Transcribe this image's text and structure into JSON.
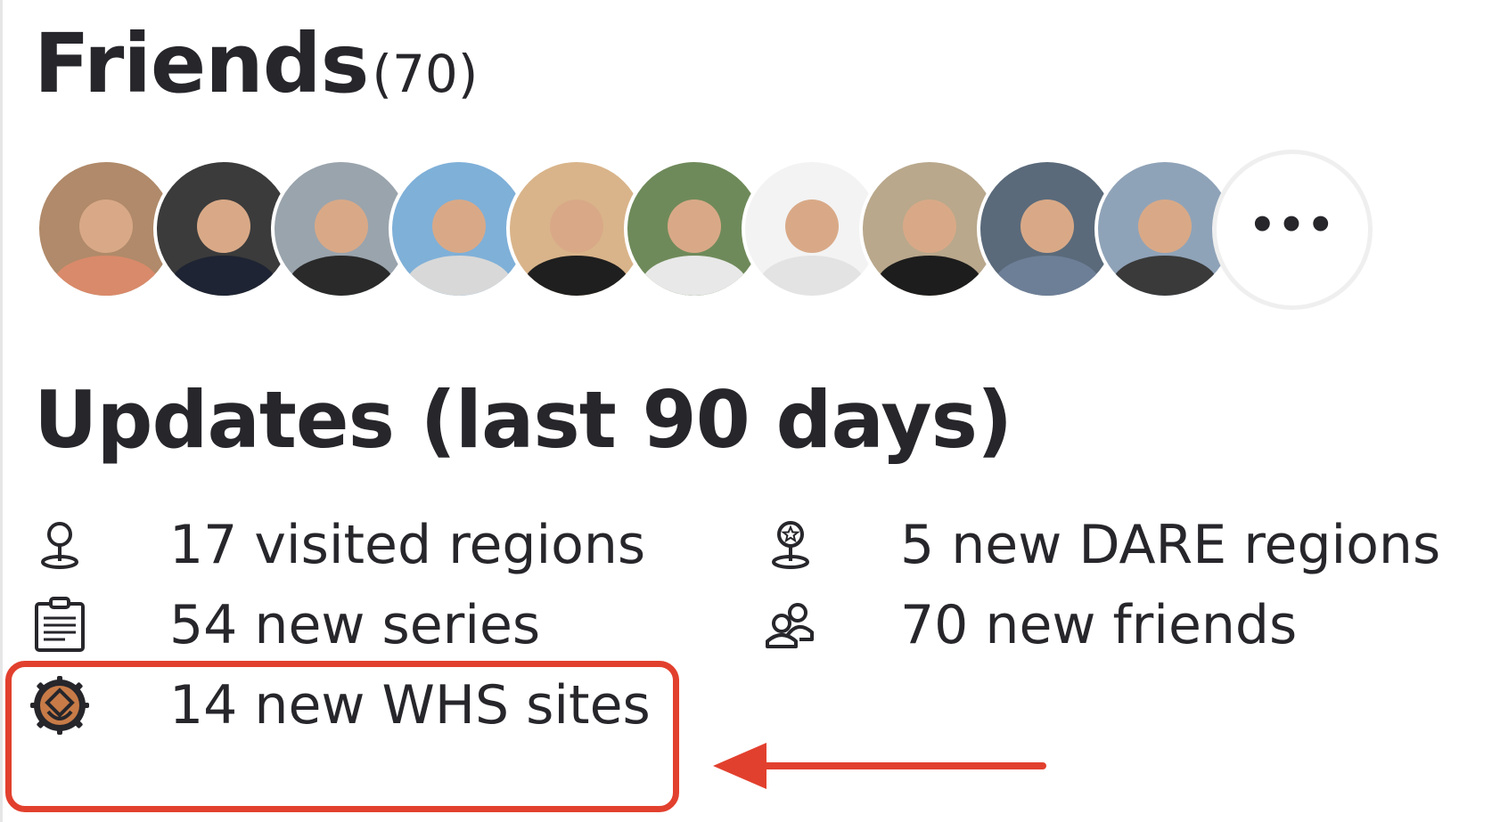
{
  "friends": {
    "title": "Friends",
    "count": "(70)",
    "more_label": "•••",
    "avatars": [
      {
        "bg": "#b08a6a",
        "torso": "#d98a6a"
      },
      {
        "bg": "#3b3b3b",
        "torso": "#1e2433"
      },
      {
        "bg": "#9aa4ad",
        "torso": "#2a2a2a"
      },
      {
        "bg": "#7fb0d8",
        "torso": "#d8d8d8"
      },
      {
        "bg": "#d9b48a",
        "torso": "#1f1f1f"
      },
      {
        "bg": "#6f8a5a",
        "torso": "#e8e8e8"
      },
      {
        "bg": "#f3f3f3",
        "torso": "#e3e3e3"
      },
      {
        "bg": "#b9a88c",
        "torso": "#1d1d1d"
      },
      {
        "bg": "#5a6a7a",
        "torso": "#6d7f97"
      },
      {
        "bg": "#8fa3b8",
        "torso": "#3a3a3a"
      }
    ]
  },
  "updates": {
    "title": "Updates (last 90 days)",
    "items": {
      "visited_regions": "17 visited regions",
      "dare_regions": "5 new DARE regions",
      "new_series": "54 new series",
      "new_friends": "70 new friends",
      "whs_sites": "14 new WHS sites"
    }
  },
  "colors": {
    "text": "#26262b",
    "highlight": "#e2402e",
    "whs_icon": "#c87b47"
  },
  "icons": {
    "visited_regions": "map-pin-icon",
    "dare_regions": "map-pin-star-icon",
    "new_series": "clipboard-list-icon",
    "new_friends": "users-icon",
    "whs_sites": "whs-badge-icon"
  }
}
